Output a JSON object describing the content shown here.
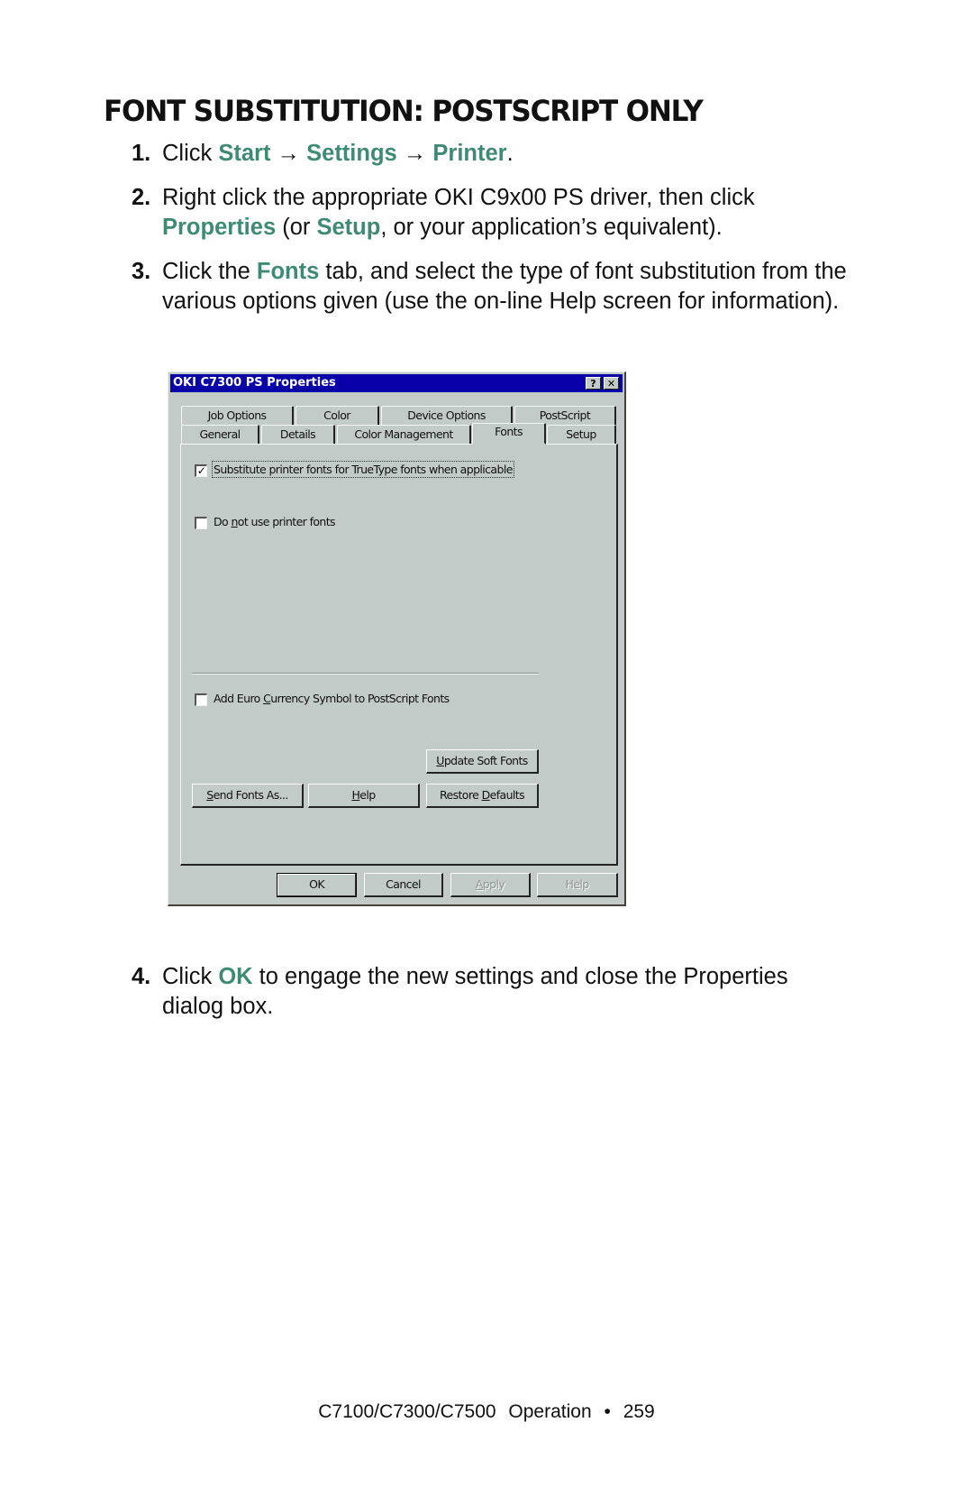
{
  "heading": "FONT SUBSTITUTION: POSTSCRIPT ONLY",
  "accent_color": "#3f8a73",
  "steps": [
    {
      "num": "1.",
      "parts": {
        "a": "Click ",
        "b": "Start",
        "c": " → ",
        "d": "Settings",
        "e": " → ",
        "f": "Printer",
        "g": "."
      }
    },
    {
      "num": "2.",
      "line1": "Right click the appropriate OKI C9x00 PS driver, then click",
      "parts": {
        "a": "Properties",
        "b": " (or ",
        "c": "Setup",
        "d": ", or your application’s equivalent)."
      }
    },
    {
      "num": "3.",
      "parts": {
        "a": "Click the ",
        "b": "Fonts",
        "c": " tab, and select the type of font substitution from the various options given (use the on-line Help screen for information)."
      }
    },
    {
      "num": "4.",
      "parts": {
        "a": "Click ",
        "b": "OK",
        "c": " to engage the new settings and close the Properties dialog box."
      }
    }
  ],
  "dialog": {
    "title": "OKI C7300 PS Properties",
    "title_buttons": {
      "help": "?",
      "close": "✕"
    },
    "tabs_row1": [
      "Job Options",
      "Color",
      "Device Options",
      "PostScript"
    ],
    "tabs_row2": [
      "General",
      "Details",
      "Color Management",
      "Fonts",
      "Setup"
    ],
    "selected_tab": "Fonts",
    "options": [
      {
        "label": "Substitute printer fonts for TrueType fonts when applicable",
        "checked": true,
        "check_glyph": "✓"
      },
      {
        "label_pre": "Do ",
        "label_u": "n",
        "label_post": "ot use printer fonts",
        "checked": false
      },
      {
        "label_pre": "Add Euro ",
        "label_u": "C",
        "label_post": "urrency Symbol to PostScript Fonts",
        "checked": false
      }
    ],
    "buttons": {
      "update_soft_fonts": {
        "u": "U",
        "rest": "pdate Soft Fonts"
      },
      "send_fonts_as": {
        "u": "S",
        "rest": "end Fonts As..."
      },
      "help": {
        "u": "H",
        "rest": "elp"
      },
      "restore_defaults": {
        "pre": "Restore ",
        "u": "D",
        "rest": "efaults"
      }
    },
    "footer_buttons": {
      "ok": "OK",
      "cancel": "Cancel",
      "apply": {
        "u": "A",
        "rest": "pply"
      },
      "help": "Help"
    }
  },
  "footer": {
    "models": "C7100/C7300/C7500",
    "section": "Operation",
    "bullet": "•",
    "page": "259"
  }
}
